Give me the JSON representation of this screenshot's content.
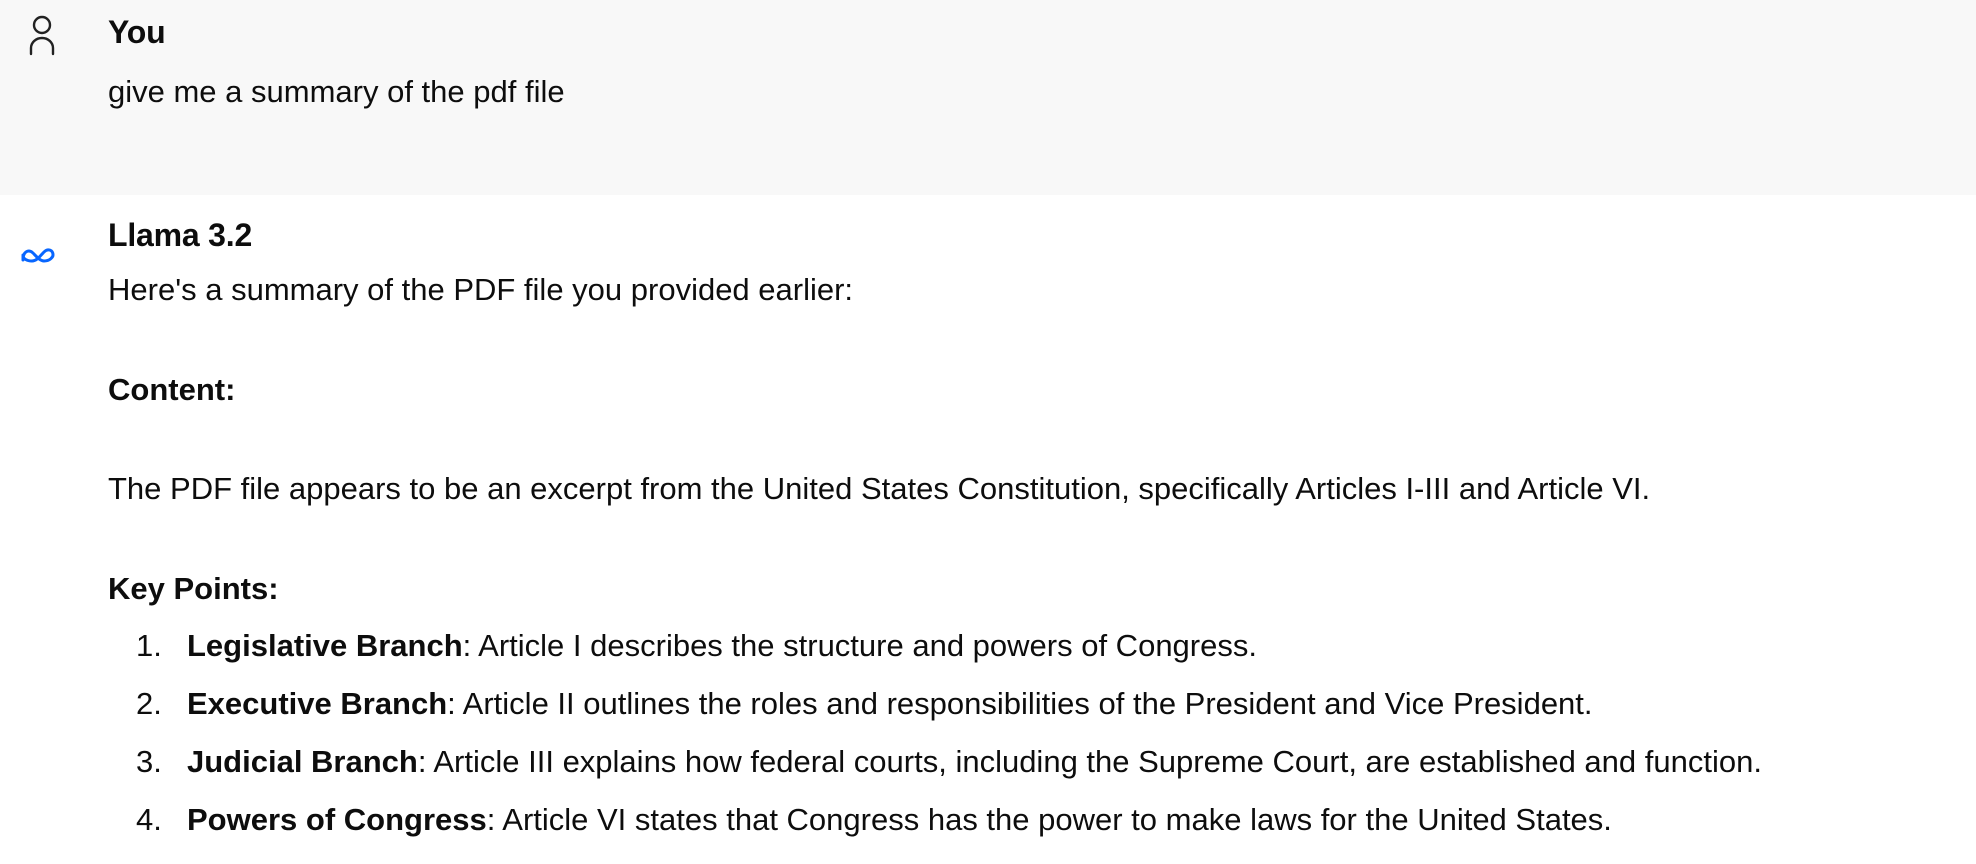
{
  "user_message": {
    "author": "You",
    "avatar_icon": "user-outline-icon",
    "text": "give me a summary of the pdf file"
  },
  "assistant_message": {
    "author": "Llama 3.2",
    "avatar_icon": "meta-infinity-logo-icon",
    "avatar_color": "#0866ff",
    "intro": "Here's a summary of the PDF file you provided earlier:",
    "content_heading": "Content:",
    "content_paragraph": "The PDF file appears to be an excerpt from the United States Constitution, specifically Articles I-III and Article VI.",
    "key_points_heading": "Key Points:",
    "key_points": [
      {
        "number": "1.",
        "title": "Legislative Branch",
        "text": ": Article I describes the structure and powers of Congress."
      },
      {
        "number": "2.",
        "title": "Executive Branch",
        "text": ": Article II outlines the roles and responsibilities of the President and Vice President."
      },
      {
        "number": "3.",
        "title": "Judicial Branch",
        "text": ": Article III explains how federal courts, including the Supreme Court, are established and function."
      },
      {
        "number": "4.",
        "title": "Powers of Congress",
        "text": ": Article VI states that Congress has the power to make laws for the United States."
      }
    ]
  }
}
